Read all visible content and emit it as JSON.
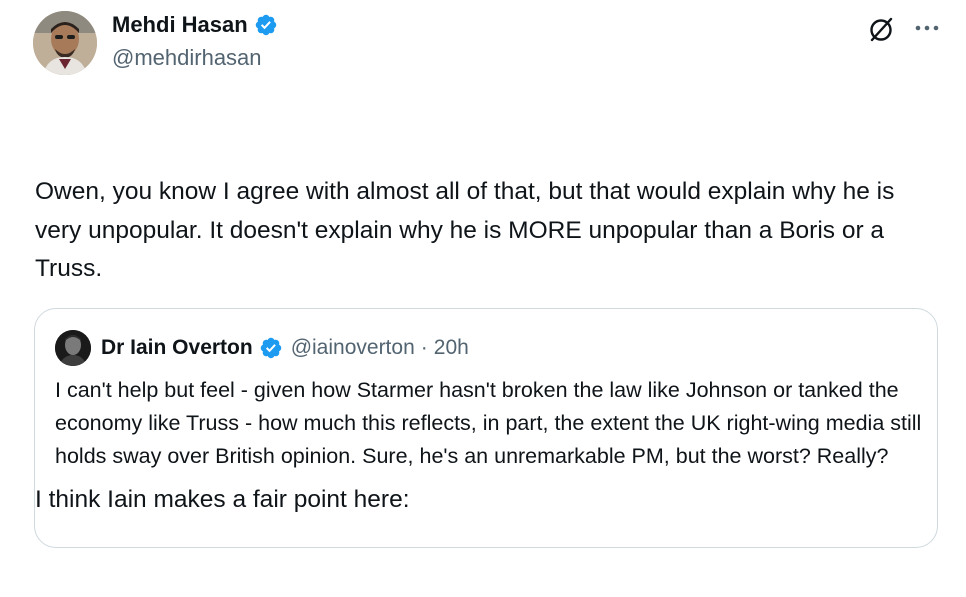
{
  "tweet": {
    "author": {
      "name": "Mehdi Hasan",
      "handle": "@mehdirhasan"
    },
    "text_paragraphs": [
      "Owen, you know I agree with almost all of that, but that would explain why he is very unpopular. It doesn't explain why he is MORE unpopular than a Boris or a Truss.",
      "I think Iain makes a fair point here:"
    ],
    "icons": {
      "grok": "grok-icon",
      "more": "more-icon",
      "verified": "verified-badge-icon"
    }
  },
  "quote": {
    "author": {
      "name": "Dr Iain Overton",
      "handle": "@iainoverton",
      "separator": "·",
      "time": "20h"
    },
    "text": "I can't help but feel - given how Starmer hasn't broken the law like Johnson or tanked the economy like Truss - how much this reflects, in part, the extent the UK right-wing media still holds sway over British opinion.  Sure, he's an unremarkable PM, but the worst?  Really?"
  },
  "colors": {
    "text": "#0f1419",
    "secondary": "#536471",
    "verified": "#1d9bf0",
    "border": "#cfd9de"
  }
}
